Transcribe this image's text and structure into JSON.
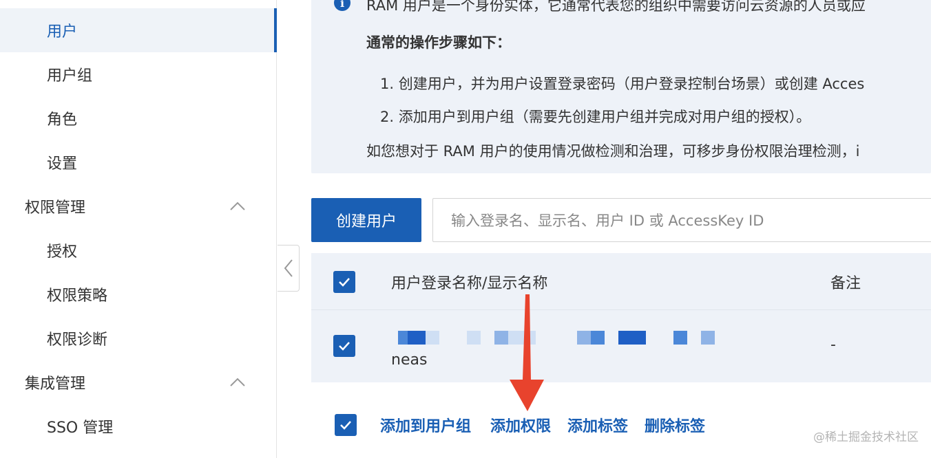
{
  "sidebar": {
    "items": [
      {
        "label": "用户",
        "level": "sub",
        "active": true
      },
      {
        "label": "用户组",
        "level": "sub"
      },
      {
        "label": "角色",
        "level": "sub"
      },
      {
        "label": "设置",
        "level": "sub"
      },
      {
        "label": "权限管理",
        "level": "group",
        "expanded": true
      },
      {
        "label": "授权",
        "level": "sub"
      },
      {
        "label": "权限策略",
        "level": "sub"
      },
      {
        "label": "权限诊断",
        "level": "sub"
      },
      {
        "label": "集成管理",
        "level": "group",
        "expanded": true
      },
      {
        "label": "SSO 管理",
        "level": "sub"
      }
    ]
  },
  "notice": {
    "icon": "info-icon",
    "line1": "RAM 用户是一个身份实体，它通常代表您的组织中需要访问云资源的人员或应",
    "line2": "通常的操作步骤如下：",
    "line3": "1. 创建用户，并为用户设置登录密码（用户登录控制台场景）或创建 Acces",
    "line4": "2. 添加用户到用户组（需要先创建用户组并完成对用户组的授权）。",
    "line5": "如您想对于 RAM 用户的使用情况做检测和治理，可移步身份权限治理检测，i"
  },
  "toolbar": {
    "create_label": "创建用户",
    "search_placeholder": "输入登录名、显示名、用户 ID 或 AccessKey ID"
  },
  "table": {
    "columns": [
      "用户登录名称/显示名称",
      "备注"
    ],
    "rows": [
      {
        "name": "neas",
        "remark": "-"
      }
    ]
  },
  "actions": [
    "添加到用户组",
    "添加权限",
    "添加标签",
    "删除标签"
  ],
  "watermark": "@稀土掘金技术社区",
  "colors": {
    "accent": "#1a5fb4",
    "panel": "#eef2f8",
    "arrow": "#e8432d"
  }
}
